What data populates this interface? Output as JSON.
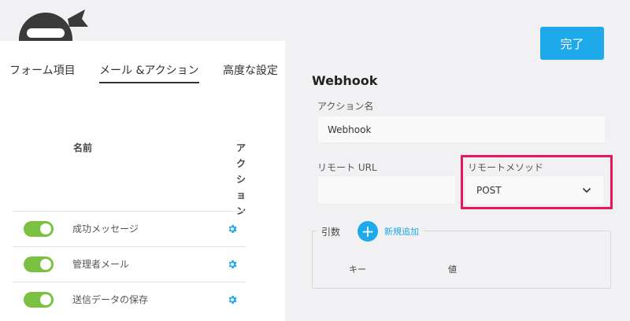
{
  "tabs": [
    "フォーム項目",
    "メール &アクション",
    "高度な設定"
  ],
  "table": {
    "name_header": "名前",
    "action_header": [
      "ア",
      "ク",
      "シ",
      "ョ",
      "ン"
    ],
    "rows": [
      {
        "label": "成功メッセージ",
        "enabled": true
      },
      {
        "label": "管理者メール",
        "enabled": true
      },
      {
        "label": "送信データの保存",
        "enabled": true
      }
    ]
  },
  "done_label": "完了",
  "settings": {
    "title": "Webhook",
    "action_name_label": "アクション名",
    "action_name_value": "Webhook",
    "remote_url_label": "リモート URL",
    "remote_url_value": "",
    "remote_method_label": "リモートメソッド",
    "remote_method_value": "POST"
  },
  "args": {
    "legend": "引数",
    "add_symbol": "+",
    "add_label": "新規追加",
    "key_header": "キー",
    "value_header": "値"
  },
  "colors": {
    "accent": "#1ea9ea",
    "toggle_on": "#7ac142",
    "highlight": "#e8175d"
  }
}
